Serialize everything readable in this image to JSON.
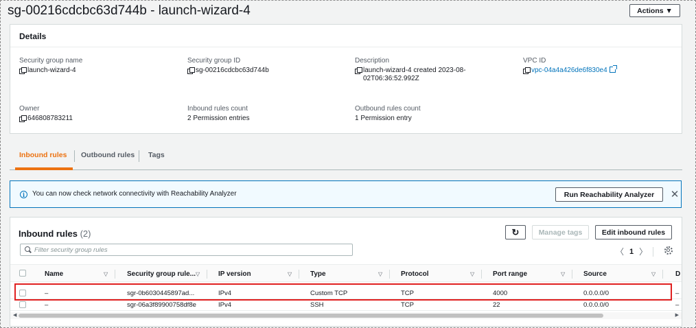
{
  "page": {
    "title": "sg-00216cdcbc63d744b - launch-wizard-4",
    "actions_label": "Actions ▼"
  },
  "details": {
    "title": "Details",
    "fields": {
      "sg_name": {
        "label": "Security group name",
        "value": "launch-wizard-4"
      },
      "sg_id": {
        "label": "Security group ID",
        "value": "sg-00216cdcbc63d744b"
      },
      "description": {
        "label": "Description",
        "value": "launch-wizard-4 created 2023-08-02T06:36:52.992Z"
      },
      "vpc_id": {
        "label": "VPC ID",
        "value": "vpc-04a4a426de6f830e4"
      },
      "owner": {
        "label": "Owner",
        "value": "646808783211"
      },
      "inbound_count": {
        "label": "Inbound rules count",
        "value": "2 Permission entries"
      },
      "outbound_count": {
        "label": "Outbound rules count",
        "value": "1 Permission entry"
      }
    }
  },
  "tabs": [
    {
      "label": "Inbound rules",
      "active": true
    },
    {
      "label": "Outbound rules",
      "active": false
    },
    {
      "label": "Tags",
      "active": false
    }
  ],
  "flash": {
    "icon": "info-icon",
    "text": "You can now check network connectivity with Reachability Analyzer",
    "button_label": "Run Reachability Analyzer",
    "close_label": "✕"
  },
  "inbound": {
    "title": "Inbound rules",
    "count": "(2)",
    "refresh_label": "↻",
    "manage_tags_label": "Manage tags",
    "edit_label": "Edit inbound rules",
    "search_placeholder": "Filter security group rules",
    "pager": {
      "prev": "〈",
      "page": "1",
      "next": "〉"
    },
    "columns": [
      "Name",
      "Security group rule...",
      "IP version",
      "Type",
      "Protocol",
      "Port range",
      "Source",
      "D"
    ],
    "rows": [
      {
        "name": "–",
        "rule_id": "sgr-0b6030445897ad...",
        "ip_version": "IPv4",
        "type": "Custom TCP",
        "protocol": "TCP",
        "port_range": "4000",
        "source": "0.0.0.0/0",
        "desc": "–"
      },
      {
        "name": "–",
        "rule_id": "sgr-06a3f89900758df8e",
        "ip_version": "IPv4",
        "type": "SSH",
        "protocol": "TCP",
        "port_range": "22",
        "source": "0.0.0.0/0",
        "desc": "–"
      }
    ],
    "highlighted_row": 1
  },
  "colors": {
    "accent": "#ec7211",
    "link": "#0073bb",
    "highlight": "#e02020"
  }
}
